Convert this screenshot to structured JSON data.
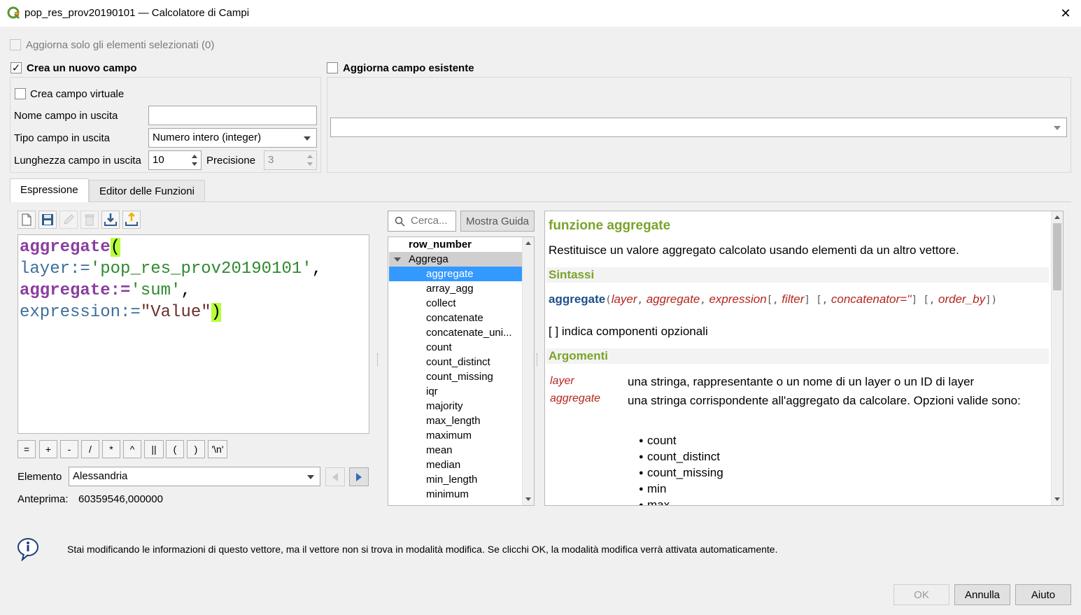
{
  "window": {
    "title": "pop_res_prov20190101 — Calcolatore di Campi"
  },
  "options": {
    "update_selected_label": "Aggiorna solo gli elementi selezionati (0)",
    "create_new_field_label": "Crea un nuovo campo",
    "update_existing_label": "Aggiorna campo esistente",
    "virtual_field_label": "Crea campo virtuale"
  },
  "new_field": {
    "name_label": "Nome campo in uscita",
    "name_value": "",
    "type_label": "Tipo campo in uscita",
    "type_value": "Numero intero (integer)",
    "length_label": "Lunghezza campo in uscita",
    "length_value": "10",
    "precision_label": "Precisione",
    "precision_value": "3"
  },
  "existing_field": {
    "selected": ""
  },
  "tabs": [
    {
      "label": "Espressione",
      "active": true
    },
    {
      "label": "Editor delle Funzioni",
      "active": false
    }
  ],
  "toolbar_icons": [
    "new-file-icon",
    "save-icon",
    "edit-icon",
    "delete-icon",
    "import-icon",
    "export-icon"
  ],
  "expression": {
    "line1": {
      "fn": "aggregate",
      "paren": "("
    },
    "line2": {
      "arg": "layer:=",
      "str": "'pop_res_prov20190101'",
      "tail": ","
    },
    "line3": {
      "arg": "aggregate:=",
      "str": "'sum'",
      "tail": ","
    },
    "line4": {
      "arg": "expression:=",
      "field": "\"Value\"",
      "paren": ")"
    }
  },
  "operators": [
    "=",
    "+",
    "-",
    "/",
    "*",
    "^",
    "||",
    "(",
    ")",
    "'\\n'"
  ],
  "element": {
    "label": "Elemento",
    "value": "Alessandria"
  },
  "preview": {
    "label": "Anteprima:",
    "value": "60359546,000000"
  },
  "search": {
    "placeholder": "Cerca..."
  },
  "show_help_label": "Mostra Guida",
  "function_tree": {
    "top_item": "row_number",
    "group": "Aggrega",
    "items": [
      "aggregate",
      "array_agg",
      "collect",
      "concatenate",
      "concatenate_uni...",
      "count",
      "count_distinct",
      "count_missing",
      "iqr",
      "majority",
      "max_length",
      "maximum",
      "mean",
      "median",
      "min_length",
      "minimum"
    ],
    "selected": "aggregate"
  },
  "help": {
    "title": "funzione aggregate",
    "description": "Restituisce un valore aggregato calcolato usando elementi da un altro vettore.",
    "syntax_header": "Sintassi",
    "syntax": {
      "fn": "aggregate",
      "open": "(",
      "a1": "layer",
      "c1": ",",
      "a2": "aggregate",
      "c2": ",",
      "a3": "expression",
      "o1": "[,",
      "a4": "filter",
      "o2": "] [,",
      "a5": "concatenator=''",
      "o3": "] [,",
      "a6": "order_by",
      "o4": "])"
    },
    "optional_note": "[ ] indica componenti opzionali",
    "args_header": "Argomenti",
    "args": [
      {
        "name": "layer",
        "desc": "una stringa, rappresentante o un nome di un layer o un ID di layer"
      },
      {
        "name": "aggregate",
        "desc": "una stringa corrispondente all'aggregato da calcolare. Opzioni valide sono:"
      }
    ],
    "options": [
      "count",
      "count_distinct",
      "count_missing",
      "min",
      "max"
    ]
  },
  "info_message": "Stai modificando le informazioni di questo vettore, ma il vettore non si trova in modalità modifica. Se clicchi OK, la modalità modifica verrà attivata automaticamente.",
  "buttons": {
    "ok": "OK",
    "cancel": "Annulla",
    "help": "Aiuto"
  }
}
